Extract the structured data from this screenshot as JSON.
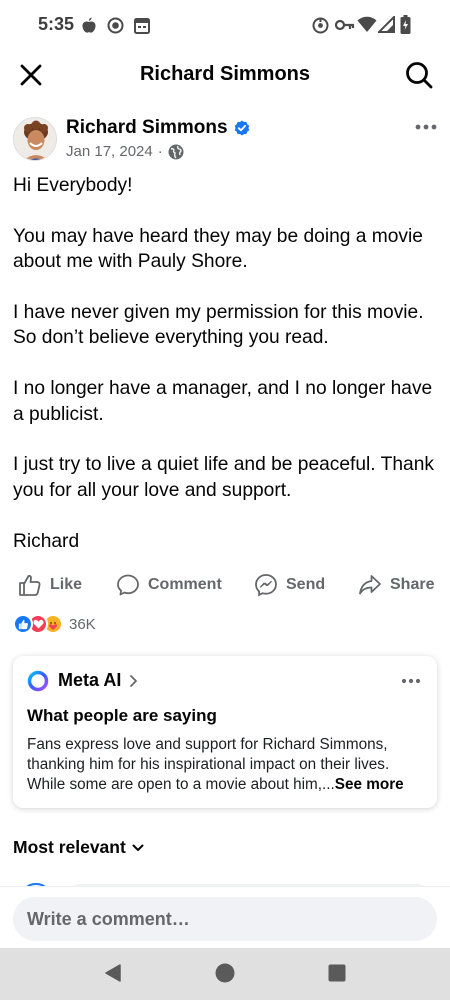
{
  "status_bar": {
    "time": "5:35",
    "left_icons": [
      "apple-icon",
      "record-icon",
      "calendar-icon"
    ],
    "right_icons": [
      "hotspot-icon",
      "vpn-key-icon",
      "wifi-icon",
      "signal-icon",
      "battery-icon"
    ]
  },
  "header": {
    "title": "Richard Simmons",
    "close_icon": "close-icon",
    "search_icon": "search-icon"
  },
  "post": {
    "author": "Richard Simmons",
    "verified": true,
    "date": "Jan 17, 2024",
    "separator": "·",
    "audience_icon": "globe-icon",
    "paragraphs": [
      "Hi Everybody!",
      "You may have heard they may be doing a movie about me with Pauly Shore.",
      "I have never given my permission for this movie.  So don’t believe everything you read.",
      "I no longer have a manager, and I no longer have a publicist.",
      "I just try to live a quiet life and be peaceful. Thank you for all your love and support.",
      "Richard"
    ]
  },
  "actions": {
    "like": "Like",
    "comment": "Comment",
    "send": "Send",
    "share": "Share"
  },
  "reactions": {
    "types": [
      "like",
      "love",
      "care"
    ],
    "count": "36K"
  },
  "meta_ai": {
    "title": "Meta AI",
    "heading": "What people are saying",
    "summary": "Fans express love and support for Richard Simmons, thanking him for his inspirational impact on their lives. While some are open to a movie about him,...",
    "see_more": "See more"
  },
  "comments": {
    "sort_label": "Most relevant",
    "input_placeholder": "Write a comment…"
  },
  "colors": {
    "facebook_blue": "#1877f2",
    "love_red": "#f33e58",
    "care_yellow": "#f7b125",
    "secondary_text": "#65676b"
  }
}
